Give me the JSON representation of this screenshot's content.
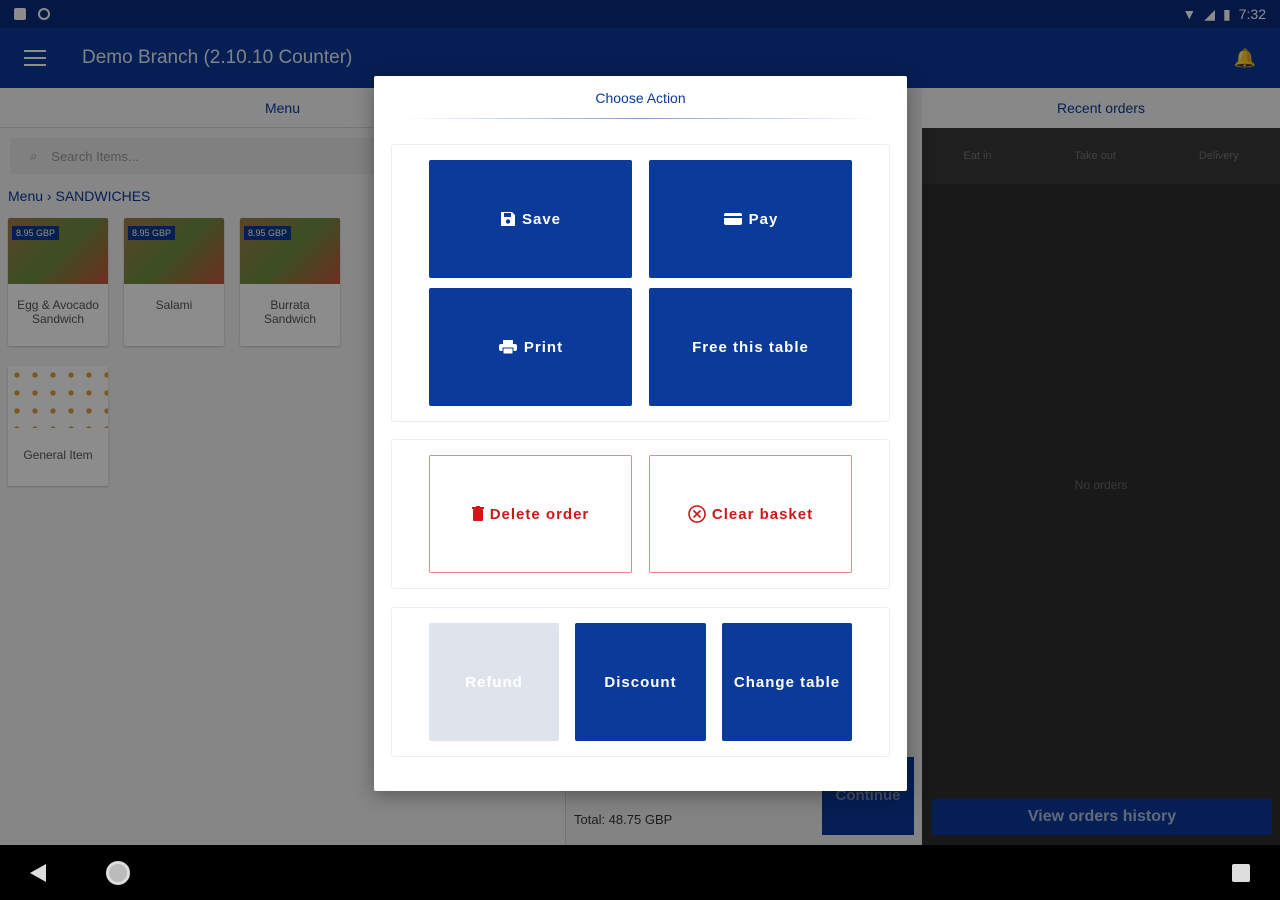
{
  "statusbar": {
    "time": "7:32"
  },
  "appbar": {
    "title": "Demo Branch (2.10.10 Counter)"
  },
  "left_panel": {
    "tab": "Menu",
    "search_placeholder": "Search Items...",
    "breadcrumb": {
      "root": "Menu",
      "current": "SANDWICHES"
    },
    "items": [
      {
        "name": "Egg & Avocado Sandwich",
        "price": "8.95 GBP"
      },
      {
        "name": "Salami",
        "price": "8.95 GBP"
      },
      {
        "name": "Burrata Sandwich",
        "price": "8.95 GBP"
      }
    ],
    "general_item": "General Item"
  },
  "mid_panel": {
    "total": "Total: 48.75 GBP",
    "continue": "Continue"
  },
  "right_panel": {
    "tab": "Recent orders",
    "sub_tabs": [
      "Eat in",
      "Take out",
      "Delivery"
    ],
    "empty": "No orders",
    "history_button": "View orders history"
  },
  "dialog": {
    "title": "Choose Action",
    "buttons": {
      "save": "Save",
      "pay": "Pay",
      "print": "Print",
      "free_table": "Free this table",
      "delete_order": "Delete order",
      "clear_basket": "Clear basket",
      "refund": "Refund",
      "discount": "Discount",
      "change_table": "Change table"
    }
  },
  "colors": {
    "primary": "#0a3a9a",
    "danger": "#d01818",
    "disabled": "#dfe4ec"
  }
}
